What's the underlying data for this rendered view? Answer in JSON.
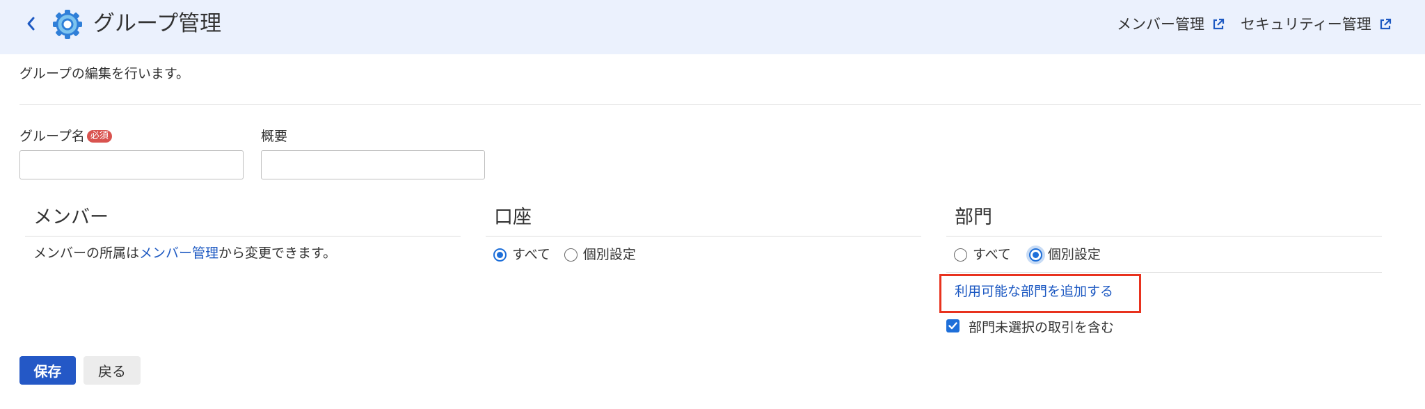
{
  "header": {
    "title": "グループ管理",
    "links": [
      {
        "label": "メンバー管理"
      },
      {
        "label": "セキュリティー管理"
      }
    ]
  },
  "description": "グループの編集を行います。",
  "form": {
    "group_name_label": "グループ名",
    "required_badge": "必須",
    "group_name_value": "",
    "summary_label": "概要",
    "summary_value": ""
  },
  "sections": {
    "members": {
      "title": "メンバー",
      "text_before": "メンバーの所属は",
      "link": "メンバー管理",
      "text_after": "から変更できます。"
    },
    "accounts": {
      "title": "口座",
      "options": [
        "すべて",
        "個別設定"
      ],
      "selected": "すべて"
    },
    "departments": {
      "title": "部門",
      "options": [
        "すべて",
        "個別設定"
      ],
      "selected": "個別設定",
      "add_link": "利用可能な部門を追加する",
      "include_unselected_label": "部門未選択の取引を含む",
      "include_unselected_checked": true
    }
  },
  "buttons": {
    "save": "保存",
    "back": "戻る"
  },
  "colors": {
    "header_bg": "#ebf1fd",
    "accent": "#1e6fd9",
    "link": "#1d59c2",
    "primary_button": "#2458c6",
    "required_badge": "#d9534f",
    "highlight_border": "#e8321e"
  }
}
